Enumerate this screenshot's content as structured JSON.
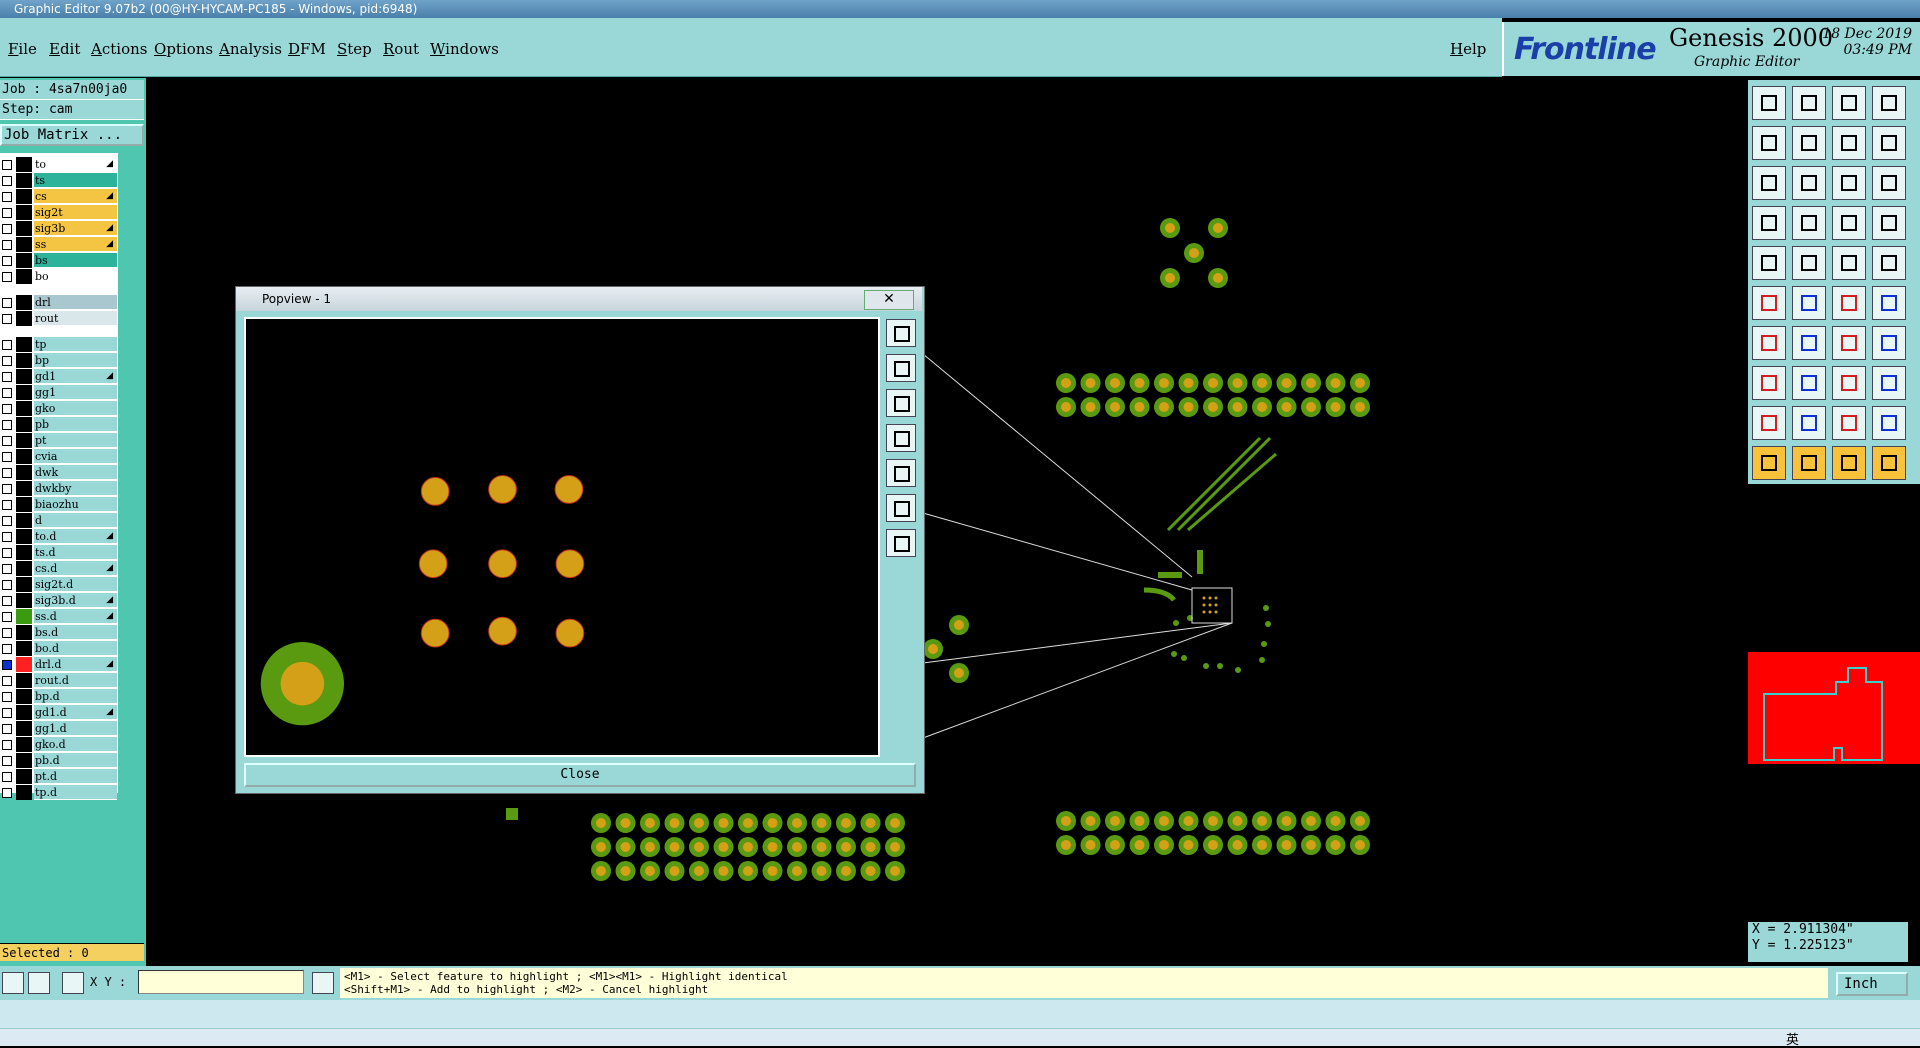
{
  "window": {
    "title": "Graphic Editor 9.07b2 (00@HY-HYCAM-PC185 - Windows, pid:6948)"
  },
  "menu": {
    "items": [
      "File",
      "Edit",
      "Actions",
      "Options",
      "Analysis",
      "DFM",
      "Step",
      "Rout",
      "Windows"
    ],
    "help": "Help"
  },
  "brand": {
    "logo": "Frontline",
    "product": "Genesis 2000",
    "subtitle": "Graphic Editor",
    "date": "18 Dec 2019",
    "time": "03:49 PM"
  },
  "job": {
    "job_line": "Job : 4sa7n00ja0",
    "step_line": "Step: cam",
    "matrix_button": "Job Matrix ..."
  },
  "layers": [
    {
      "name": "to",
      "color": "#ffffff",
      "arrow": true
    },
    {
      "name": "ts",
      "color": "#2db39a",
      "arrow": false
    },
    {
      "name": "cs",
      "color": "#f4c542",
      "arrow": true
    },
    {
      "name": "sig2t",
      "color": "#f4c542",
      "arrow": false
    },
    {
      "name": "sig3b",
      "color": "#f4c542",
      "arrow": true
    },
    {
      "name": "ss",
      "color": "#f4c542",
      "arrow": true
    },
    {
      "name": "bs",
      "color": "#2db39a",
      "arrow": false
    },
    {
      "name": "bo",
      "color": "#ffffff",
      "arrow": false
    },
    {
      "name": "drl",
      "color": "#a9c7cf",
      "arrow": false,
      "gap": true
    },
    {
      "name": "rout",
      "color": "#d9e6ea",
      "arrow": false
    },
    {
      "name": "tp",
      "color": "#9ad8d8",
      "arrow": false,
      "gap": true
    },
    {
      "name": "bp",
      "color": "#9ad8d8",
      "arrow": false
    },
    {
      "name": "gd1",
      "color": "#9ad8d8",
      "arrow": true
    },
    {
      "name": "gg1",
      "color": "#9ad8d8",
      "arrow": false
    },
    {
      "name": "gko",
      "color": "#9ad8d8",
      "arrow": false
    },
    {
      "name": "pb",
      "color": "#9ad8d8",
      "arrow": false
    },
    {
      "name": "pt",
      "color": "#9ad8d8",
      "arrow": false
    },
    {
      "name": "cvia",
      "color": "#9ad8d8",
      "arrow": false
    },
    {
      "name": "dwk",
      "color": "#9ad8d8",
      "arrow": false
    },
    {
      "name": "dwkby",
      "color": "#9ad8d8",
      "arrow": false
    },
    {
      "name": "biaozhu",
      "color": "#9ad8d8",
      "arrow": false
    },
    {
      "name": "d",
      "color": "#9ad8d8",
      "arrow": false
    },
    {
      "name": "to.d",
      "color": "#9ad8d8",
      "arrow": true
    },
    {
      "name": "ts.d",
      "color": "#9ad8d8",
      "arrow": false
    },
    {
      "name": "cs.d",
      "color": "#9ad8d8",
      "arrow": true
    },
    {
      "name": "sig2t.d",
      "color": "#9ad8d8",
      "arrow": false
    },
    {
      "name": "sig3b.d",
      "color": "#9ad8d8",
      "arrow": true
    },
    {
      "name": "ss.d",
      "color": "#9ad8d8",
      "arrow": true,
      "swatch": "#3a9a10"
    },
    {
      "name": "bs.d",
      "color": "#9ad8d8",
      "arrow": false
    },
    {
      "name": "bo.d",
      "color": "#9ad8d8",
      "arrow": false
    },
    {
      "name": "drl.d",
      "color": "#9ad8d8",
      "arrow": true,
      "swatch": "#ff2020",
      "checked": true
    },
    {
      "name": "rout.d",
      "color": "#9ad8d8",
      "arrow": false
    },
    {
      "name": "bp.d",
      "color": "#9ad8d8",
      "arrow": false
    },
    {
      "name": "gd1.d",
      "color": "#9ad8d8",
      "arrow": true
    },
    {
      "name": "gg1.d",
      "color": "#9ad8d8",
      "arrow": false
    },
    {
      "name": "gko.d",
      "color": "#9ad8d8",
      "arrow": false
    },
    {
      "name": "pb.d",
      "color": "#9ad8d8",
      "arrow": false
    },
    {
      "name": "pt.d",
      "color": "#9ad8d8",
      "arrow": false
    },
    {
      "name": "tp.d",
      "color": "#9ad8d8",
      "arrow": false
    }
  ],
  "status": {
    "selected": "Selected : 0",
    "xy_label": "X Y :",
    "xy_value": ""
  },
  "prompt": {
    "line1": "<M1> - Select feature to highlight ; <M1><M1> - Highlight identical",
    "line2": "<Shift+M1> - Add to highlight ; <M2> - Cancel highlight"
  },
  "coords": {
    "x": "X = 2.911304\"",
    "y": "Y = 1.225123\""
  },
  "unit": {
    "label": "Inch"
  },
  "popview": {
    "title": "Popview - 1",
    "close_x": "✕",
    "close_button": "Close"
  },
  "taskbar": {
    "ime": "英"
  },
  "colors": {
    "panel": "#9ad8d8",
    "pad": "#d4a017",
    "pad_ring": "#5a9a10",
    "overview": "#ff0000"
  }
}
